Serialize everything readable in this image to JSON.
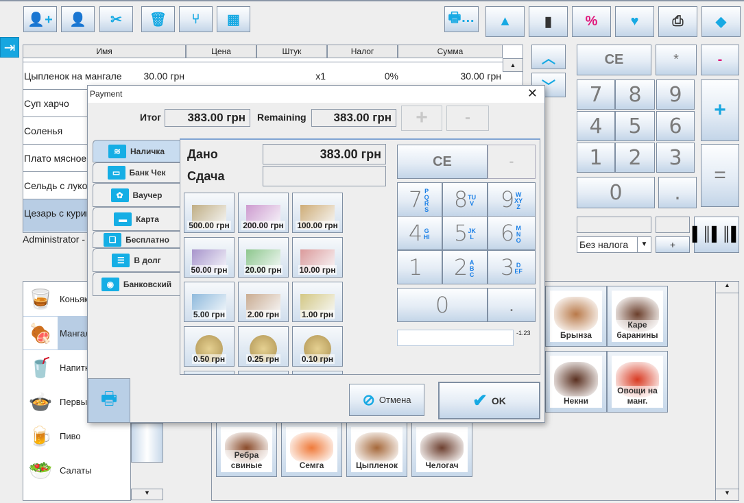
{
  "toolbar": {
    "left": [
      {
        "name": "add-user",
        "g": "👤+"
      },
      {
        "name": "user",
        "g": "👤"
      },
      {
        "name": "cut",
        "g": "✂"
      },
      {
        "name": "trash",
        "g": "🗑"
      },
      {
        "name": "split",
        "g": "⑂"
      },
      {
        "name": "grid",
        "g": "▦"
      }
    ],
    "right": [
      {
        "name": "print",
        "g": "🖶…"
      },
      {
        "name": "warning",
        "g": "▲"
      },
      {
        "name": "terminal",
        "g": "▮"
      },
      {
        "name": "percent",
        "g": "%"
      },
      {
        "name": "heart",
        "g": "♥"
      },
      {
        "name": "receipt-printer",
        "g": "⎙"
      },
      {
        "name": "eraser",
        "g": "◆"
      }
    ]
  },
  "order": {
    "headers": [
      "Имя",
      "Цена",
      "Штук",
      "Налог",
      "Сумма"
    ],
    "rows": [
      {
        "name": "Цыпленок на мангале",
        "price": "30.00 грн",
        "qty": "x1",
        "tax": "0%",
        "sum": "30.00 грн"
      },
      {
        "name": "Суп харчо"
      },
      {
        "name": "Соленья"
      },
      {
        "name": "Плато мясное"
      },
      {
        "name": "Сельдь с луком"
      },
      {
        "name": "Цезарь с курицей"
      }
    ],
    "status": "Administrator -"
  },
  "numpad": {
    "ce": "CE",
    "star": "*",
    "minus": "-",
    "plus": "+",
    "equals": "=",
    "dot": ".",
    "digits": [
      "1",
      "2",
      "3",
      "4",
      "5",
      "6",
      "7",
      "8",
      "9",
      "0"
    ],
    "tax_select": "Без налога",
    "add": "+"
  },
  "categories": [
    {
      "label": "Коньяк",
      "g": "🥃"
    },
    {
      "label": "Мангал",
      "g": "🍖"
    },
    {
      "label": "Напитки",
      "g": "🥤"
    },
    {
      "label": "Первые",
      "g": "🍲"
    },
    {
      "label": "Пиво",
      "g": "🍺"
    },
    {
      "label": "Салаты",
      "g": "🥗"
    }
  ],
  "products": [
    {
      "label": "Брынза",
      "c": "#b97a4a"
    },
    {
      "label": "Каре баранины",
      "c": "#6b3f2c"
    },
    {
      "label": "Некни",
      "c": "#5a3020"
    },
    {
      "label": "Овощи на манг.",
      "c": "#d83a22"
    },
    {
      "label": "Ребра свиные",
      "c": "#8a4b2a"
    },
    {
      "label": "Семга",
      "c": "#ef7a3a"
    },
    {
      "label": "Цыпленок",
      "c": "#a5683a"
    },
    {
      "label": "Челогач",
      "c": "#6d4030"
    }
  ],
  "dialog": {
    "title": "Payment",
    "total_label": "Итог",
    "total": "383.00 грн",
    "remaining_label": "Remaining",
    "remaining": "383.00 грн",
    "plus": "+",
    "minus": "-",
    "tabs": [
      {
        "label": "Наличка",
        "g": "≋"
      },
      {
        "label": "Банк Чек",
        "g": "▭"
      },
      {
        "label": "Ваучер",
        "g": "✿"
      },
      {
        "label": "Карта",
        "g": "▬"
      },
      {
        "label": "Бесплатно",
        "g": "❏"
      },
      {
        "label": "В долг",
        "g": "☰"
      },
      {
        "label": "Банковский",
        "g": "◉"
      }
    ],
    "given_label": "Дано",
    "given": "383.00 грн",
    "change_label": "Сдача",
    "change": "",
    "bills": [
      {
        "v": "500.00 грн",
        "c": "#b8a270"
      },
      {
        "v": "200.00 грн",
        "c": "#c88bc8"
      },
      {
        "v": "100.00 грн",
        "c": "#c9a060"
      },
      {
        "v": "50.00 грн",
        "c": "#9b84c4"
      },
      {
        "v": "20.00 грн",
        "c": "#7cbf7a"
      },
      {
        "v": "10.00 грн",
        "c": "#d88a8a"
      },
      {
        "v": "5.00 грн",
        "c": "#7fb0d8"
      },
      {
        "v": "2.00 грн",
        "c": "#c4a080"
      },
      {
        "v": "1.00 грн",
        "c": "#cfc070"
      },
      {
        "v": "0.50 грн",
        "coin": true
      },
      {
        "v": "0.25 грн",
        "coin": true
      },
      {
        "v": "0.10 грн",
        "coin": true
      }
    ],
    "keypad": {
      "ce": "CE",
      "minus": "-",
      "keys": [
        {
          "d": "7",
          "s": "PQRS"
        },
        {
          "d": "8",
          "s": "TUV"
        },
        {
          "d": "9",
          "s": "WXYZ"
        },
        {
          "d": "4",
          "s": "GHI"
        },
        {
          "d": "5",
          "s": "JKL"
        },
        {
          "d": "6",
          "s": "MNO"
        },
        {
          "d": "1",
          "s": ""
        },
        {
          "d": "2",
          "s": "ABC"
        },
        {
          "d": "3",
          "s": "DEF"
        }
      ],
      "zero": "0",
      "dot": "."
    },
    "input_value": "",
    "hint": "-1.23",
    "cancel": "Отмена",
    "ok": "OK"
  }
}
